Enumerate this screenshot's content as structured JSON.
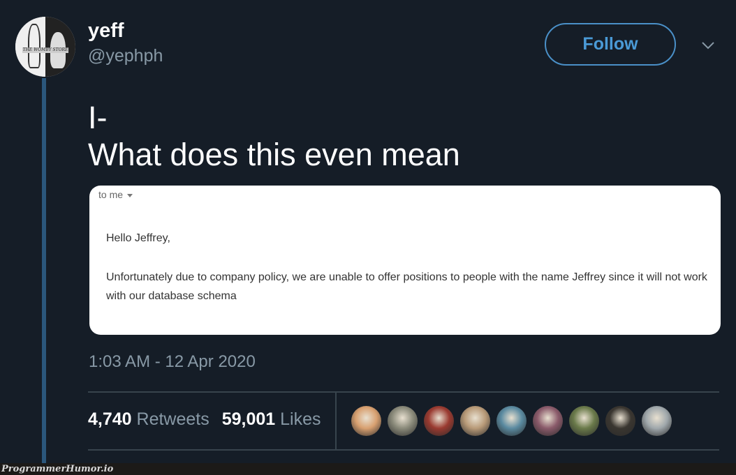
{
  "tweet": {
    "author": {
      "display_name": "yeff",
      "handle": "@yephph",
      "avatar_caption": "THE WOMBY STORE"
    },
    "follow_label": "Follow",
    "more_icon": "chevron-down-icon",
    "text_lines": [
      "I-",
      "What does this even mean"
    ],
    "timestamp": "1:03 AM - 12 Apr 2020",
    "stats": {
      "retweets_count": "4,740",
      "retweets_label": "Retweets",
      "likes_count": "59,001",
      "likes_label": "Likes"
    },
    "likers": [
      {
        "name": "liker-1",
        "color": "#d8a070"
      },
      {
        "name": "liker-2",
        "color": "#8a8a7a"
      },
      {
        "name": "liker-3",
        "color": "#9a3a30"
      },
      {
        "name": "liker-4",
        "color": "#b89a78"
      },
      {
        "name": "liker-5",
        "color": "#5a8aa0"
      },
      {
        "name": "liker-6",
        "color": "#8a5a6a"
      },
      {
        "name": "liker-7",
        "color": "#6a7a4a"
      },
      {
        "name": "liker-8",
        "color": "#3a3630"
      },
      {
        "name": "liker-9",
        "color": "#a0a8ac"
      }
    ]
  },
  "email": {
    "to_label": "to me",
    "greeting": "Hello Jeffrey,",
    "body": "Unfortunately due to company policy, we are unable to offer positions to people with the name Jeffrey since it will not work with our database schema"
  },
  "watermark": "ProgrammerHumor.io",
  "colors": {
    "background": "#151d27",
    "accent": "#4a9ad6",
    "thread_line": "#2b577c",
    "muted_text": "#8899a6"
  }
}
